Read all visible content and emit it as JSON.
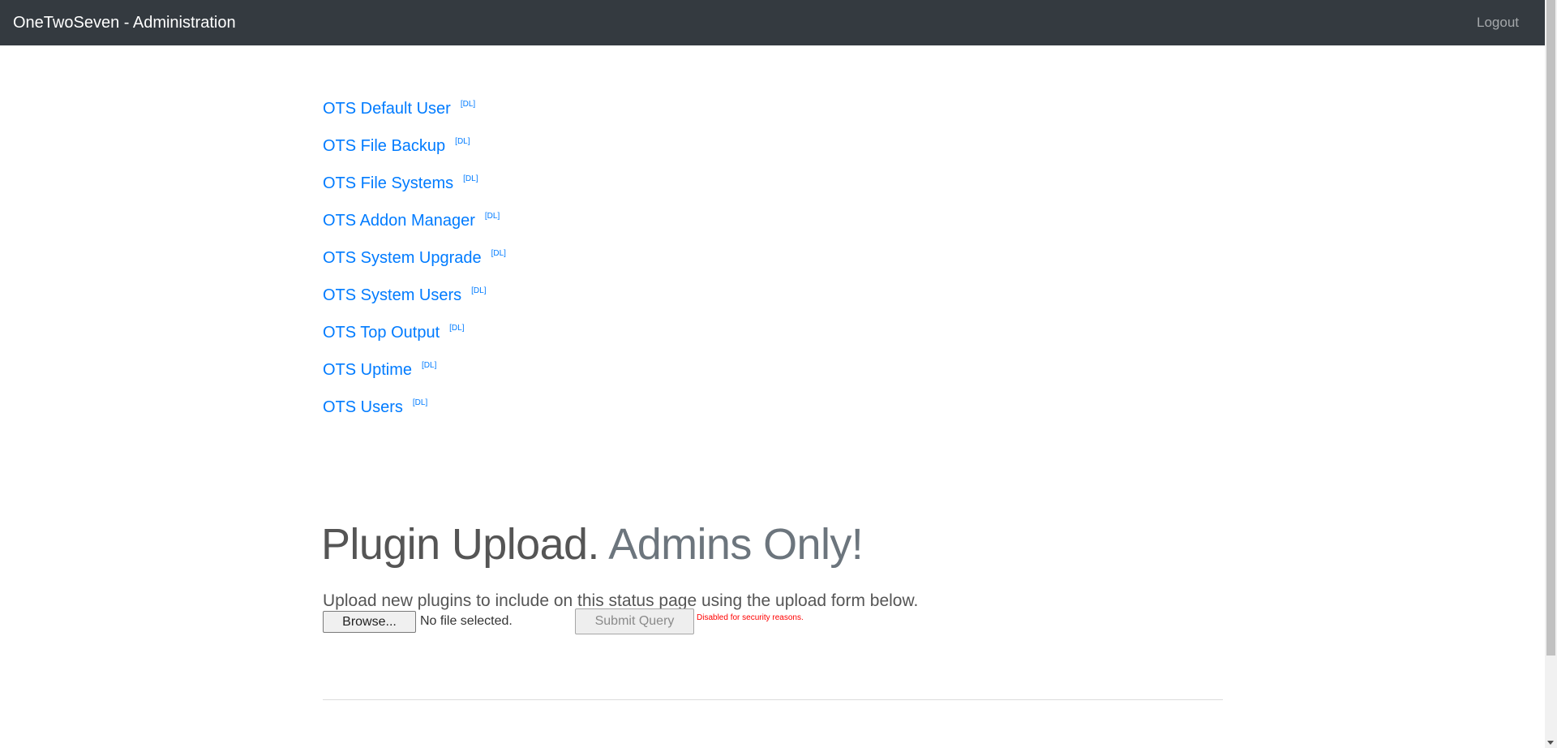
{
  "navbar": {
    "brand": "OneTwoSeven - Administration",
    "logout_label": "Logout"
  },
  "links": [
    {
      "label": "OTS Default User",
      "dl": "[DL]"
    },
    {
      "label": "OTS File Backup",
      "dl": "[DL]"
    },
    {
      "label": "OTS File Systems",
      "dl": "[DL]"
    },
    {
      "label": "OTS Addon Manager",
      "dl": "[DL]"
    },
    {
      "label": "OTS System Upgrade",
      "dl": "[DL]"
    },
    {
      "label": "OTS System Users",
      "dl": "[DL]"
    },
    {
      "label": "OTS Top Output",
      "dl": "[DL]"
    },
    {
      "label": "OTS Uptime",
      "dl": "[DL]"
    },
    {
      "label": "OTS Users",
      "dl": "[DL]"
    }
  ],
  "upload": {
    "heading_main": "Plugin Upload.",
    "heading_muted": "Admins Only!",
    "lead": "Upload new plugins to include on this status page using the upload form below.",
    "browse_label": "Browse...",
    "file_status": "No file selected.",
    "submit_label": "Submit Query",
    "security_note": "Disabled for security reasons."
  },
  "colors": {
    "navbar_bg": "#343a40",
    "link": "#007bff",
    "warning": "#ff0000"
  }
}
